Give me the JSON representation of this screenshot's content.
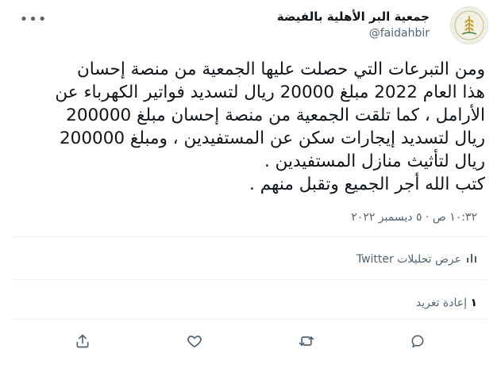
{
  "author": {
    "name": "جمعية البر الأهلية بالفيضة",
    "handle": "@faidahbir"
  },
  "tweet": {
    "text": "ومن التبرعات التي حصلت عليها الجمعية من منصة إحسان\nهذا العام 2022 مبلغ 20000 ريال لتسديد فواتير الكهرباء عن\nالأرامل ، كما تلقت الجمعية من منصة إحسان مبلغ 200000\nريال لتسديد إيجارات سكن عن المستفيدين ، ومبلغ 200000\nريال لتأثيث منازل المستفيدين .\nكتب الله أجر الجميع وتقبل منهم .",
    "timestamp": "١٠:٣٢ ص · ٥ ديسمبر ٢٠٢٢"
  },
  "analytics": {
    "label": "عرض تحليلات Twitter"
  },
  "stats": {
    "retweet_count": "١",
    "retweet_label": "إعادة تغريد"
  },
  "icons": {
    "more": "more-icon",
    "analytics": "bar-chart-icon",
    "reply": "reply-icon",
    "retweet": "retweet-icon",
    "like": "heart-icon",
    "share": "share-icon"
  }
}
